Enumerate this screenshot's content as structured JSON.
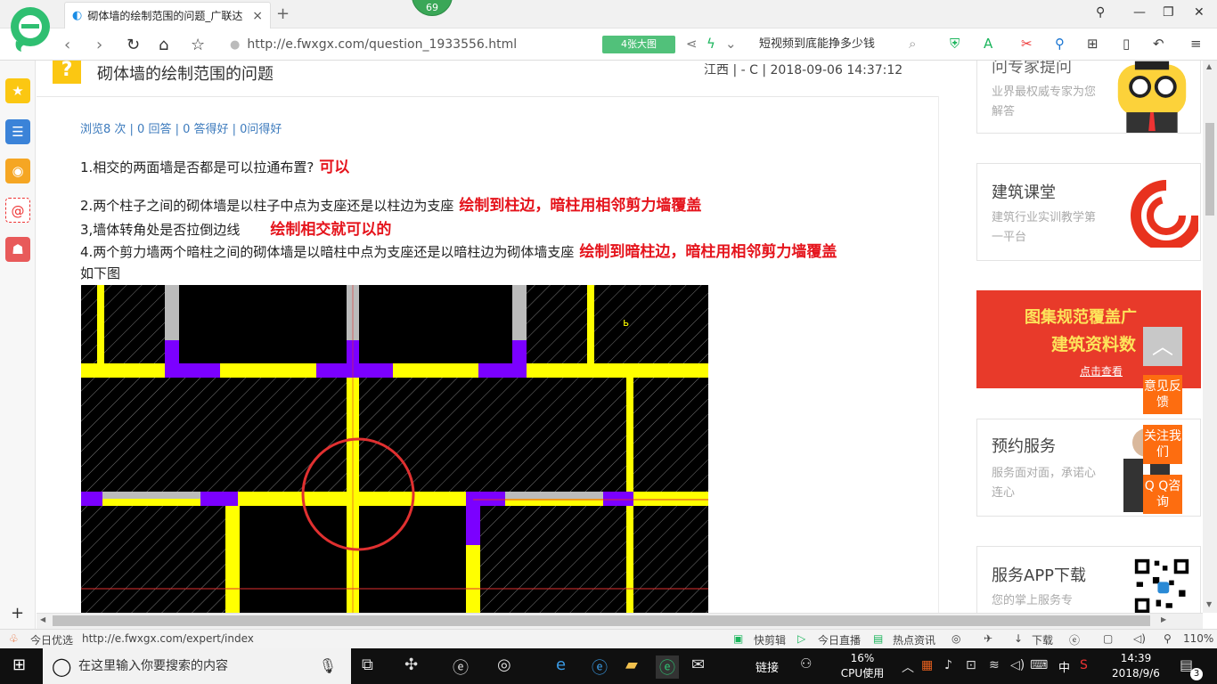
{
  "browser": {
    "tab_title": "砌体墙的绘制范围的问题_广联达",
    "tab_close": "×",
    "new_tab": "+",
    "badge_count": "69",
    "url": "http://e.fwxgx.com/question_1933556.html",
    "big_image_button": "4张大图",
    "search_text": "短视频到底能挣多少钱"
  },
  "question": {
    "title": "砌体墙的绘制范围的问题",
    "meta": "江西 | - C | 2018-09-06 14:37:12",
    "stats": "浏览8 次 | 0 回答 | 0 答得好 | 0问得好",
    "lines": [
      {
        "text": "1.相交的两面墙是否都是可以拉通布置?",
        "answer": "可以"
      },
      {
        "text": "2.两个柱子之间的砌体墙是以柱子中点为支座还是以柱边为支座",
        "answer": "绘制到柱边，暗柱用相邻剪力墙覆盖"
      },
      {
        "text": "3,墙体转角处是否拉倒边线",
        "answer": "绘制相交就可以的"
      },
      {
        "text": "4.两个剪力墙两个暗柱之间的砌体墙是以暗柱中点为支座还是以暗柱边为砌体墙支座",
        "answer": "绘制到暗柱边，暗柱用相邻剪力墙覆盖"
      },
      {
        "text": "如下图",
        "answer": ""
      }
    ]
  },
  "sidebar_right": {
    "cards": [
      {
        "heading": "问专家提问",
        "sub": "业界最权威专家为您解答"
      },
      {
        "heading": "建筑课堂",
        "sub": "建筑行业实训教学第一平台"
      },
      {
        "heading": "",
        "banner1": "图集规范覆盖广",
        "banner2": "建筑资料数",
        "banner3": "点击查看"
      },
      {
        "heading": "预约服务",
        "sub": "服务面对面，承诺心连心"
      },
      {
        "heading": "服务APP下载",
        "sub": "您的掌上服务专"
      }
    ],
    "float_buttons": [
      "意见反馈",
      "关注我们",
      "Q Q咨询"
    ]
  },
  "statusbar": {
    "left_label": "今日优选",
    "hover_url": "http://e.fwxgx.com/expert/index",
    "items": [
      "快剪辑",
      "今日直播",
      "热点资讯",
      "下载",
      "110%"
    ]
  },
  "taskbar": {
    "search_placeholder": "在这里输入你要搜索的内容",
    "link_label": "链接",
    "cpu_percent": "16%",
    "cpu_label": "CPU使用",
    "ime": "中",
    "time": "14:39",
    "date": "2018/9/6",
    "notify_count": "3"
  },
  "colors": {
    "answer_red": "#e5141c",
    "stats_blue": "#3d7bbd",
    "wall_yellow": "#ffff00",
    "column_purple": "#7b00ff",
    "circle_red": "#e03030"
  }
}
